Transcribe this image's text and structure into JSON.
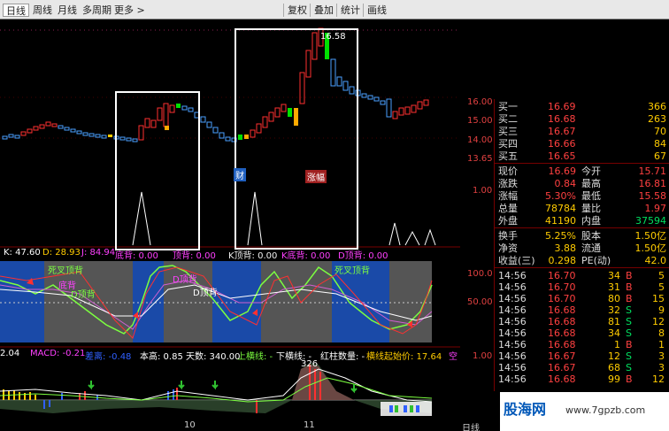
{
  "toolbar": {
    "tabs": [
      "日线",
      "周线",
      "月线",
      "多周期",
      "更多 >"
    ],
    "right_buttons": [
      "复权",
      "叠加",
      "统计",
      "画线"
    ]
  },
  "price_axis": {
    "labels": [
      "16.00",
      "15.00",
      "14.00",
      "13.65",
      "1.00",
      "100.0",
      "50.00",
      "1.00"
    ]
  },
  "main_chart": {
    "high_mark": "16.58",
    "tag_red": "涨幅",
    "tag_blue": "财",
    "volume_labels": [
      "底背: 0.00",
      "顶背: 0.00",
      "K顶背: 0.00",
      "K底背: 0.00",
      "D顶背: 0.00"
    ]
  },
  "kdj": {
    "k_label": "K: 47.60",
    "d_label": "D: 28.93",
    "j_label": "J: 84.94",
    "sig_a": "死叉顶背",
    "sig_b": "底背",
    "sig_c": "D顶背",
    "sig_d": "死叉顶背",
    "sig_e": "D顶背",
    "sig_f": "D顶背"
  },
  "macd": {
    "left_val": "2.04",
    "macd_label": "MACD: -0.21",
    "diff_label": "差离: -0.48",
    "stats_text": "本高: 0.85  天数: 340.00",
    "up_line": "上横线: -",
    "down_line": "下横线: -",
    "red_bar": "红柱数量: -",
    "start_price": "横线起始价: 17.64",
    "empty": "空",
    "peak": "326",
    "date_1": "10",
    "date_2": "11",
    "period": "日线"
  },
  "quote": {
    "bids": [
      {
        "label": "买一",
        "price": "16.69",
        "vol": "366"
      },
      {
        "label": "买二",
        "price": "16.68",
        "vol": "263"
      },
      {
        "label": "买三",
        "price": "16.67",
        "vol": "70"
      },
      {
        "label": "买四",
        "price": "16.66",
        "vol": "84"
      },
      {
        "label": "买五",
        "price": "16.65",
        "vol": "67"
      }
    ],
    "stats": [
      {
        "l1": "现价",
        "v1": "16.69",
        "l2": "今开",
        "v2": "15.71"
      },
      {
        "l1": "涨跌",
        "v1": "0.84",
        "l2": "最高",
        "v2": "16.81"
      },
      {
        "l1": "涨幅",
        "v1": "5.30%",
        "l2": "最低",
        "v2": "15.58"
      },
      {
        "l1": "总量",
        "v1": "78784",
        "l2": "量比",
        "v2": "1.97"
      },
      {
        "l1": "外盘",
        "v1": "41190",
        "l2": "内盘",
        "v2": "37594"
      }
    ],
    "stats2": [
      {
        "l1": "换手",
        "v1": "5.25%",
        "l2": "股本",
        "v2": "1.50亿"
      },
      {
        "l1": "净资",
        "v1": "3.88",
        "l2": "流通",
        "v2": "1.50亿"
      },
      {
        "l1": "收益(三)",
        "v1": "0.298",
        "l2": "PE(动)",
        "v2": "42.0"
      }
    ],
    "ticks": [
      {
        "t": "14:56",
        "p": "16.70",
        "v": "34",
        "s": "B",
        "n": "5"
      },
      {
        "t": "14:56",
        "p": "16.70",
        "v": "31",
        "s": "B",
        "n": "5"
      },
      {
        "t": "14:56",
        "p": "16.70",
        "v": "80",
        "s": "B",
        "n": "15"
      },
      {
        "t": "14:56",
        "p": "16.68",
        "v": "32",
        "s": "S",
        "n": "9"
      },
      {
        "t": "14:56",
        "p": "16.68",
        "v": "81",
        "s": "S",
        "n": "12"
      },
      {
        "t": "14:56",
        "p": "16.68",
        "v": "34",
        "s": "S",
        "n": "8"
      },
      {
        "t": "14:56",
        "p": "16.68",
        "v": "1",
        "s": "B",
        "n": "1"
      },
      {
        "t": "14:56",
        "p": "16.67",
        "v": "12",
        "s": "S",
        "n": "3"
      },
      {
        "t": "14:56",
        "p": "16.67",
        "v": "68",
        "s": "S",
        "n": "3"
      },
      {
        "t": "14:56",
        "p": "16.68",
        "v": "99",
        "s": "B",
        "n": "12"
      }
    ]
  },
  "watermark": {
    "logo": "股海网",
    "url": "www.7gpzb.com"
  }
}
